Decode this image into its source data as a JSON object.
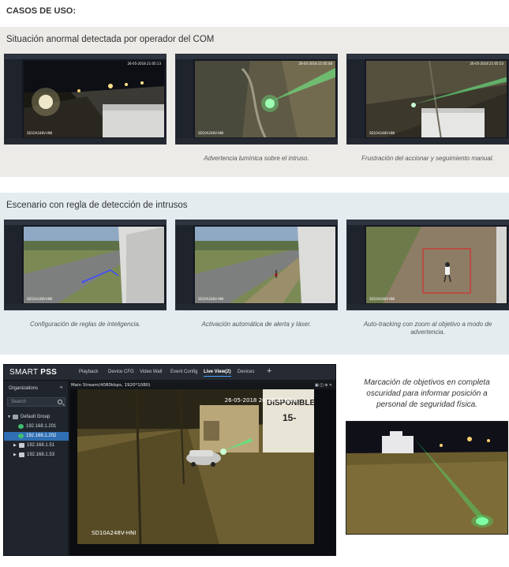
{
  "page": {
    "title": "CASOS DE USO:"
  },
  "section1": {
    "title": "Situación anormal detectada por operador del COM",
    "frames": [
      {
        "stamp": "26-05-2018 21:05:13",
        "camera": "SD10A248V-HNI",
        "caption": ""
      },
      {
        "stamp": "26-05-2018 21:05:48",
        "camera": "SD10A248V-HNI",
        "caption": "Advertencia lumínica sobre el intruso."
      },
      {
        "stamp": "26-05-2018 21:05:53",
        "camera": "SD10A248V-HNI",
        "caption": "Frustración del accionar y seguimiento manual."
      }
    ]
  },
  "section2": {
    "title": "Escenario con regla de detección de intrusos",
    "frames": [
      {
        "stamp": "",
        "camera": "SD10A248V-HNI",
        "caption": "Configuración de reglas de inteligencia."
      },
      {
        "stamp": "",
        "camera": "SD10A248V-HNI",
        "caption": "Activación automática de alerta y láser."
      },
      {
        "stamp": "",
        "camera": "SD10A248V-HNI",
        "caption": "Auto-tracking con zoom al objetivo a modo de advertencia."
      }
    ]
  },
  "pss": {
    "logo_light": "SMART ",
    "logo_bold": "PSS",
    "tabs": [
      "Playback",
      "Device CFG",
      "Video Wall",
      "Event Config",
      "Live View(2)",
      "Devices"
    ],
    "active_tab": "Live View(2)",
    "add_tab": "+",
    "organizations_label": "Organizations",
    "search_placeholder": "Search",
    "tree": [
      {
        "label": "Default Group",
        "level": 0,
        "expanded": true,
        "selected": false
      },
      {
        "label": "192.168.1.201",
        "level": 1,
        "expanded": false,
        "selected": false
      },
      {
        "label": "192.168.1.202",
        "level": 1,
        "expanded": false,
        "selected": true
      },
      {
        "label": "192.168.1.51",
        "level": 1,
        "expanded": false,
        "selected": false
      },
      {
        "label": "192.168.1.53",
        "level": 1,
        "expanded": false,
        "selected": false
      }
    ],
    "stream_label": "Main Stream(4080kbps, 1920*1080)",
    "stamp": "26-05-2018 20:38:33 Mon",
    "camera": "SD10A248V-HNI",
    "sign_text": "DISPONIBLE"
  },
  "side": {
    "text": "Marcación de objetivos en completa oscuridad para informar posición a personal de seguridad física."
  },
  "colors": {
    "laser": "#39ff7a",
    "accent": "#2f6fb3",
    "detection_box": "#e02020",
    "rule_line": "#3a4dff"
  }
}
